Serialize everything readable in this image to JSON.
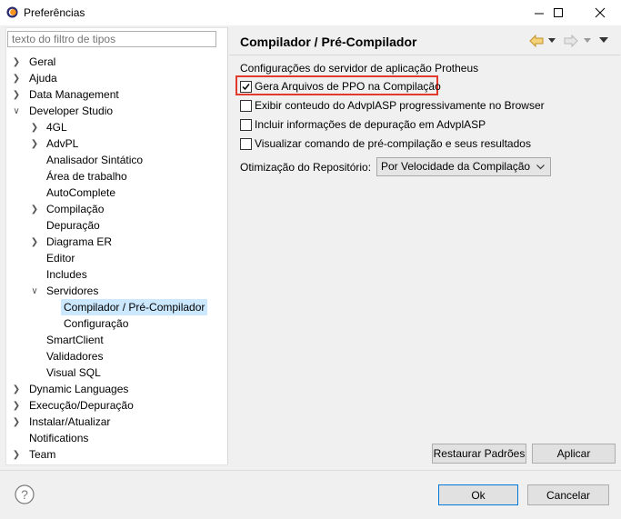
{
  "window": {
    "title": "Preferências"
  },
  "filter": {
    "placeholder": "texto do filtro de tipos"
  },
  "tree": {
    "geral": "Geral",
    "ajuda": "Ajuda",
    "data_management": "Data Management",
    "developer_studio": "Developer Studio",
    "gl4": "4GL",
    "advpl": "AdvPL",
    "analisador": "Analisador Sintático",
    "area": "Área de trabalho",
    "autocomplete": "AutoComplete",
    "compilacao": "Compilação",
    "depuracao": "Depuração",
    "diagrama": "Diagrama ER",
    "editor": "Editor",
    "includes": "Includes",
    "servidores": "Servidores",
    "compilador": "Compilador / Pré-Compilador",
    "configuracao": "Configuração",
    "smartclient": "SmartClient",
    "validadores": "Validadores",
    "visualsql": "Visual SQL",
    "dynamic": "Dynamic Languages",
    "execucao": "Execução/Depuração",
    "instalar": "Instalar/Atualizar",
    "notifications": "Notifications",
    "team": "Team"
  },
  "page": {
    "title": "Compilador / Pré-Compilador",
    "section": "Configurações do servidor de aplicação Protheus",
    "options": [
      {
        "label": "Gera Arquivos de PPO na Compilação",
        "checked": true
      },
      {
        "label": "Exibir conteudo do AdvplASP progressivamente no Browser",
        "checked": false
      },
      {
        "label": "Incluir informações de depuração em AdvplASP",
        "checked": false
      },
      {
        "label": "Visualizar comando de pré-compilação e seus resultados",
        "checked": false
      }
    ],
    "repo_label": "Otimização do Repositório:",
    "repo_value": "Por Velocidade da Compilação"
  },
  "buttons": {
    "restore": "Restaurar Padrões",
    "apply": "Aplicar",
    "ok": "Ok",
    "cancel": "Cancelar"
  },
  "colors": {
    "highlight": "#e23b2e",
    "selection": "#cce8ff",
    "accent": "#0078d7"
  }
}
